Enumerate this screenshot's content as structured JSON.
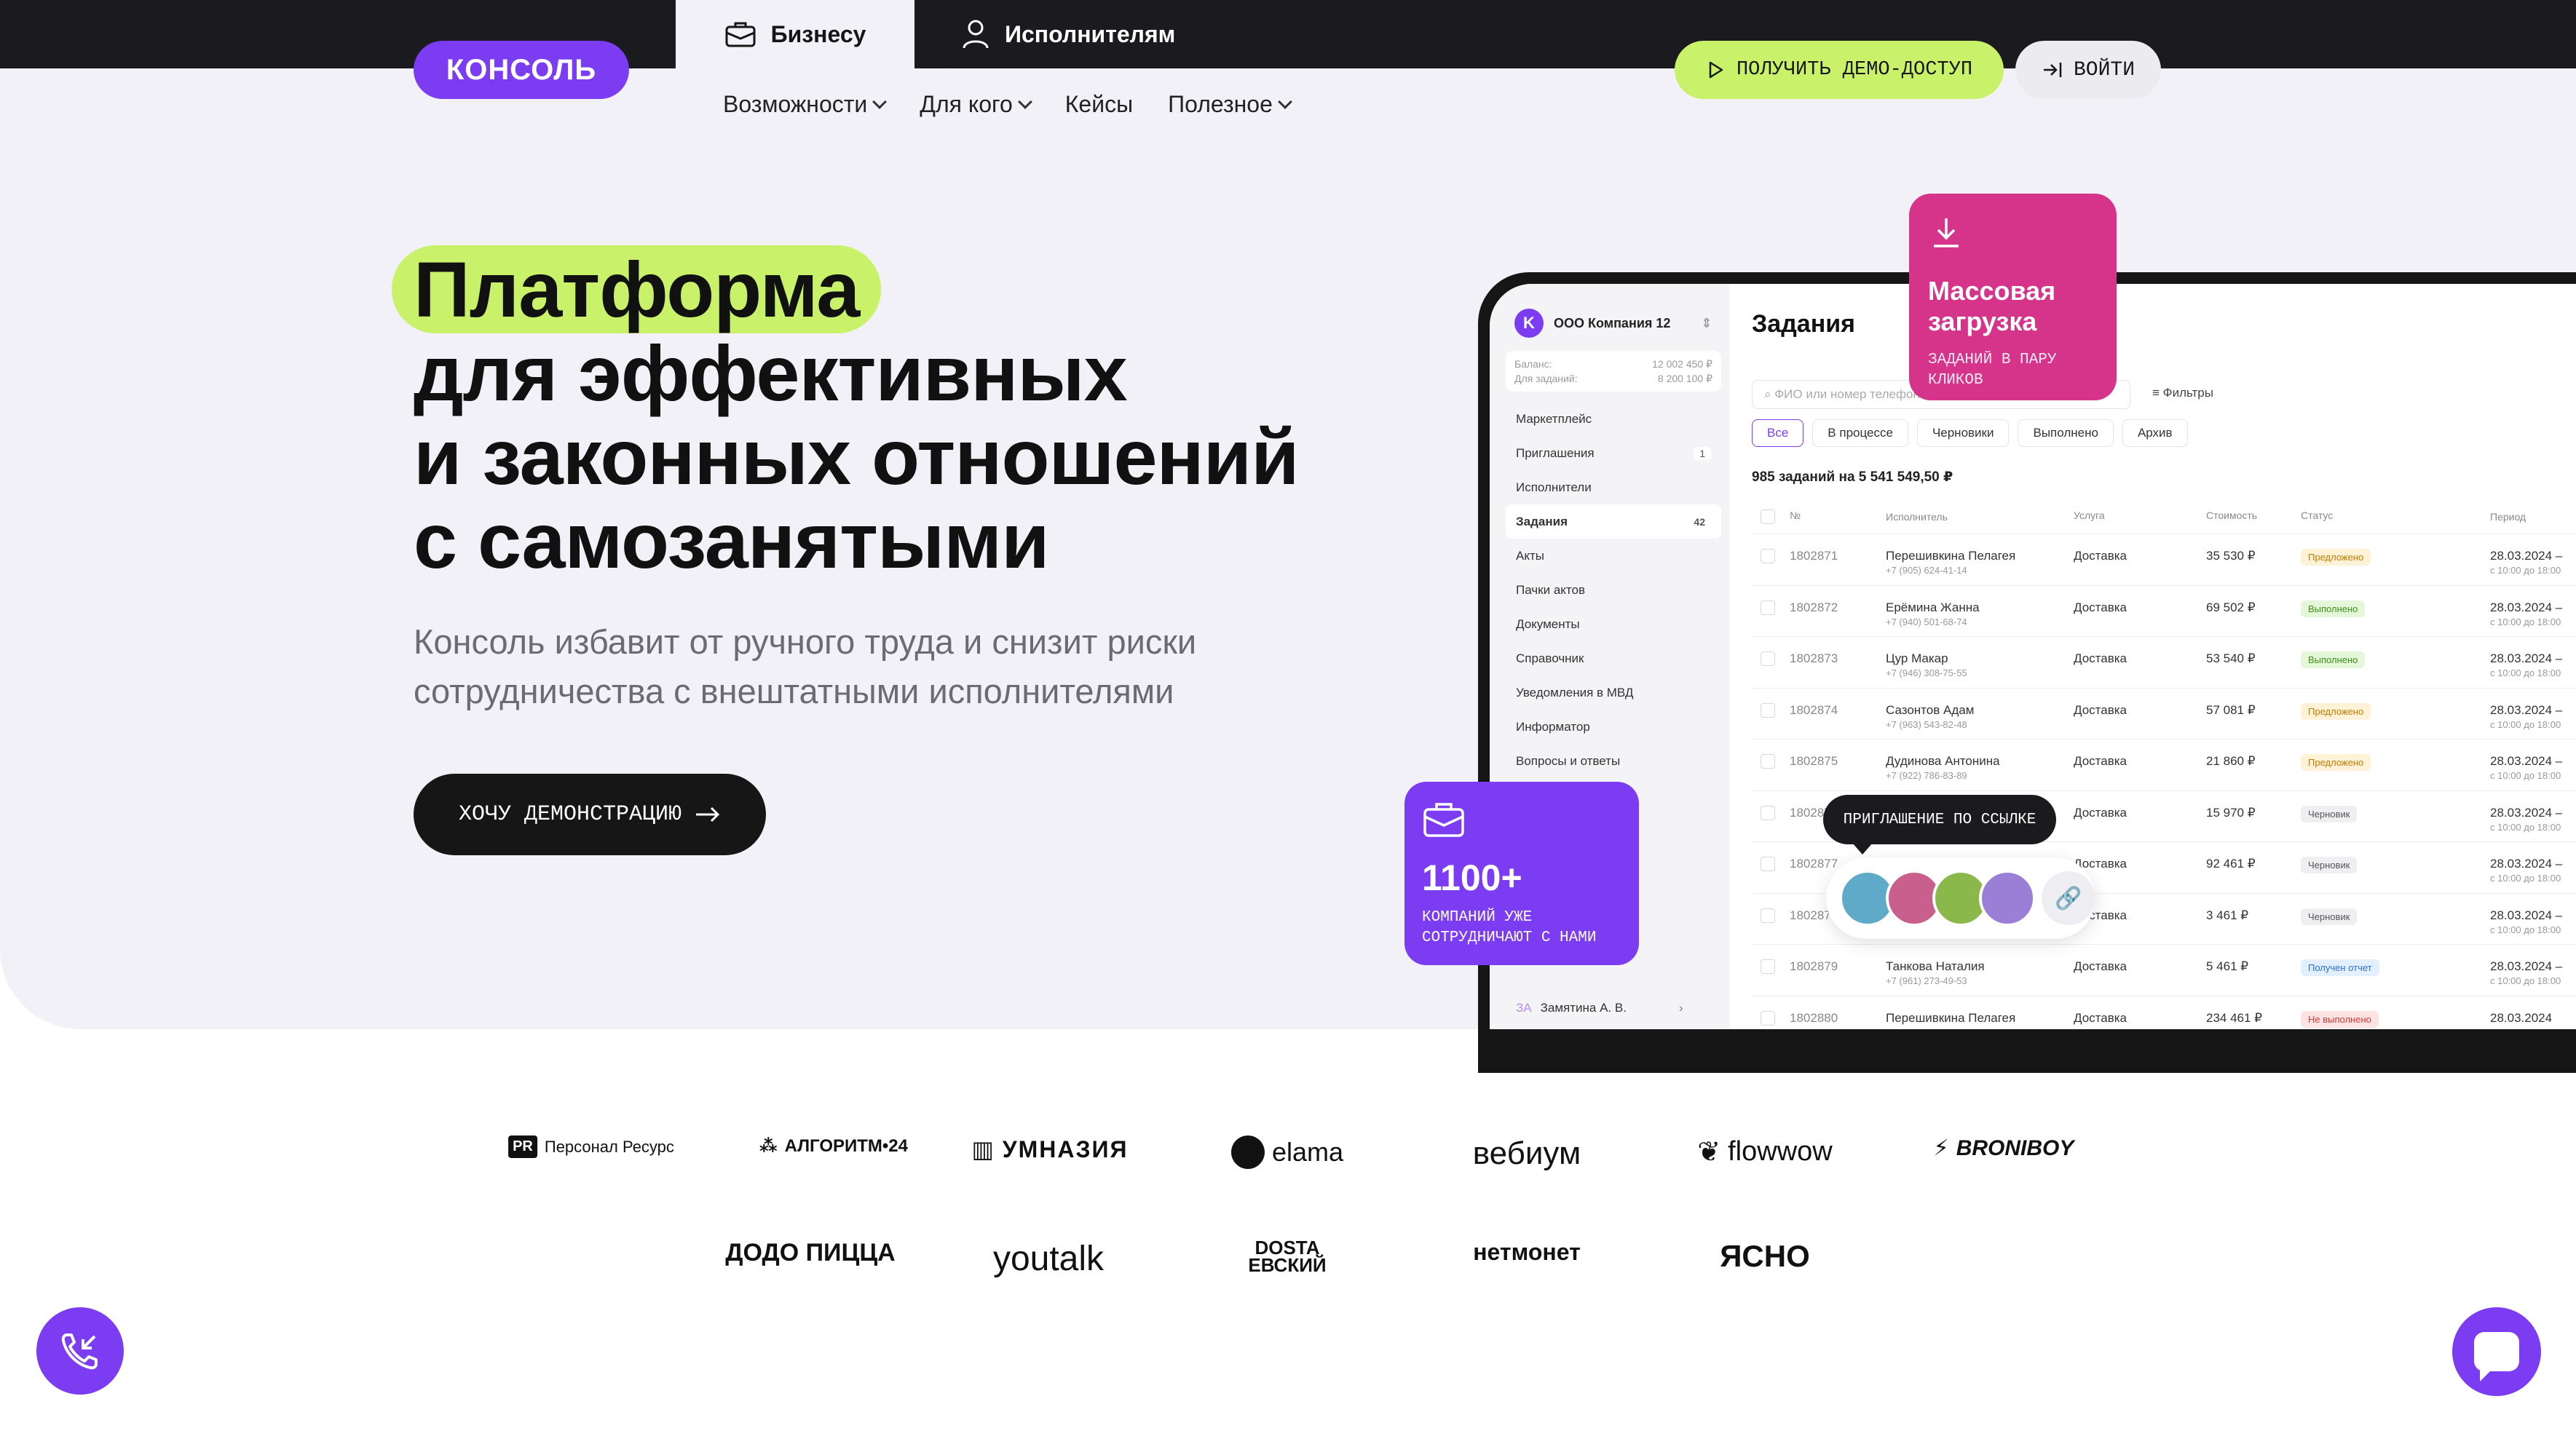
{
  "top_tabs": {
    "business": "Бизнесу",
    "executors": "Исполнителям"
  },
  "logo": "КОНСОЛЬ",
  "nav": [
    "Возможности",
    "Для кого",
    "Кейсы",
    "Полезное"
  ],
  "header_buttons": {
    "demo": "ПОЛУЧИТЬ ДЕМО-ДОСТУП",
    "login": "ВОЙТИ"
  },
  "hero": {
    "line1": "Платформа",
    "line2": "для эффективных",
    "line3": "и законных отношений",
    "line4": "с самозанятыми",
    "subtitle_line1": "Консоль избавит от ручного труда и снизит риски",
    "subtitle_line2": "сотрудничества с внештатными исполнителями",
    "cta": "ХОЧУ ДЕМОНСТРАЦИЮ"
  },
  "dashboard": {
    "company": "ООО Компания 12",
    "balance_label": "Баланс:",
    "balance_value": "12 002 450 ₽",
    "tasks_label": "Для заданий:",
    "tasks_value": "8 200 100 ₽",
    "menu": [
      {
        "label": "Маркетплейс",
        "count": ""
      },
      {
        "label": "Приглашения",
        "count": "1"
      },
      {
        "label": "Исполнители",
        "count": ""
      },
      {
        "label": "Задания",
        "count": "42"
      },
      {
        "label": "Акты",
        "count": ""
      },
      {
        "label": "Пачки актов",
        "count": ""
      },
      {
        "label": "Документы",
        "count": ""
      },
      {
        "label": "Справочник",
        "count": ""
      },
      {
        "label": "Уведомления в МВД",
        "count": ""
      },
      {
        "label": "Информатор",
        "count": ""
      },
      {
        "label": "Вопросы и ответы",
        "count": ""
      }
    ],
    "user_initials": "ЗА",
    "user_name": "Замятина А. В.",
    "title": "Задания",
    "search_placeholder": "ФИО или номер телефона",
    "filters": "Фильтры",
    "chips": [
      "Все",
      "В процессе",
      "Черновики",
      "Выполнено",
      "Архив"
    ],
    "summary": "985 заданий на 5 541 549,50 ₽",
    "columns": [
      "№",
      "Исполнитель",
      "Услуга",
      "Стоимость",
      "Статус",
      "Период"
    ],
    "rows": [
      {
        "id": "1802871",
        "name": "Перешивкина Пелагея",
        "phone": "+7 (905) 624-41-14",
        "service": "Доставка",
        "cost": "35 530 ₽",
        "status": "Предложено",
        "status_kind": "pred",
        "date": "28.03.2024 –",
        "time": "с 10:00 до 18:00"
      },
      {
        "id": "1802872",
        "name": "Ерёмина Жанна",
        "phone": "+7 (940) 501-68-74",
        "service": "Доставка",
        "cost": "69 502 ₽",
        "status": "Выполнено",
        "status_kind": "done",
        "date": "28.03.2024 –",
        "time": "с 10:00 до 18:00"
      },
      {
        "id": "1802873",
        "name": "Цур Макар",
        "phone": "+7 (946) 308-75-55",
        "service": "Доставка",
        "cost": "53 540 ₽",
        "status": "Выполнено",
        "status_kind": "done",
        "date": "28.03.2024 –",
        "time": "с 10:00 до 18:00"
      },
      {
        "id": "1802874",
        "name": "Сазонтов Адам",
        "phone": "+7 (963) 543-82-48",
        "service": "Доставка",
        "cost": "57 081 ₽",
        "status": "Предложено",
        "status_kind": "pred",
        "date": "28.03.2024 –",
        "time": "с 10:00 до 18:00"
      },
      {
        "id": "1802875",
        "name": "Дудинова Антонина",
        "phone": "+7 (922) 786-83-89",
        "service": "Доставка",
        "cost": "21 860 ₽",
        "status": "Предложено",
        "status_kind": "pred",
        "date": "28.03.2024 –",
        "time": "с 10:00 до 18:00"
      },
      {
        "id": "1802876",
        "name": "",
        "phone": "",
        "service": "Доставка",
        "cost": "15 970 ₽",
        "status": "Черновик",
        "status_kind": "draft",
        "date": "28.03.2024 –",
        "time": "с 10:00 до 18:00"
      },
      {
        "id": "1802877",
        "name": "",
        "phone": "",
        "service": "Доставка",
        "cost": "92 461 ₽",
        "status": "Черновик",
        "status_kind": "draft",
        "date": "28.03.2024 –",
        "time": "с 10:00 до 18:00"
      },
      {
        "id": "1802878",
        "name": "",
        "phone": "",
        "service": "Доставка",
        "cost": "3 461 ₽",
        "status": "Черновик",
        "status_kind": "draft",
        "date": "28.03.2024 –",
        "time": "с 10:00 до 18:00"
      },
      {
        "id": "1802879",
        "name": "Танкова Наталия",
        "phone": "+7 (961) 273-49-53",
        "service": "Доставка",
        "cost": "5 461 ₽",
        "status": "Получен отчет",
        "status_kind": "rep",
        "date": "28.03.2024 –",
        "time": "с 10:00 до 18:00"
      },
      {
        "id": "1802880",
        "name": "Перешивкина Пелагея",
        "phone": "",
        "service": "Доставка",
        "cost": "234 461 ₽",
        "status": "Не выполнено",
        "status_kind": "fail",
        "date": "28.03.2024",
        "time": ""
      }
    ]
  },
  "cards": {
    "bulk_title": "Массовая загрузка",
    "bulk_sub": "ЗАДАНИЙ В ПАРУ КЛИКОВ",
    "companies_number": "1100+",
    "companies_sub": "КОМПАНИЙ УЖЕ СОТРУДНИЧАЮТ С НАМИ",
    "invite_tooltip": "ПРИГЛАШЕНИЕ ПО ССЫЛКЕ"
  },
  "partners_row1": [
    "Персонал Ресурс",
    "АЛГОРИТМ•24",
    "УМНАЗИЯ",
    "elama",
    "вебиум",
    "flowwow",
    "BRONIBOY"
  ],
  "partners_row2": [
    "ДОДО ПИЦЦА",
    "youtalk",
    "DOSTA EВСКИЙ",
    "нетмонет",
    "ЯСНО"
  ],
  "colors": {
    "brand_violet": "#7b3cf2",
    "accent_lime": "#c9f26a",
    "accent_pink": "#d6338a",
    "dark": "#1b1a1e"
  }
}
